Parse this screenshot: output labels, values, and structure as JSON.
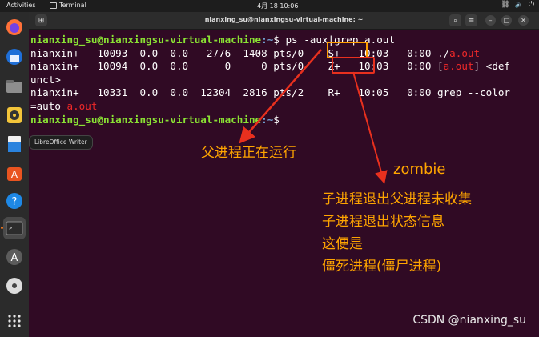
{
  "topbar": {
    "activities": "Activities",
    "app_name": "Terminal",
    "clock": "4月 18  10:06"
  },
  "window": {
    "title": "nianxing_su@nianxingsu-virtual-machine: ~"
  },
  "terminal": {
    "line1_prompt": "nianxing_su@nianxingsu-virtual-machine",
    "line1_path": ":~",
    "line1_cmd": "$ ps -aux|grep a.out",
    "line2_pre": "nianxin+   10093  0.0  0.0   2776  1408 pts/0    S+   10:03   0:00 ./",
    "line2_red": "a.out",
    "line3_pre": "nianxin+   10094  0.0  0.0      0     0 pts/0    Z+   10:03   0:00 [",
    "line3_red": "a.out",
    "line3_post": "] <def",
    "line4": "unct>",
    "line5": "nianxin+   10331  0.0  0.0  12304  2816 pts/2    R+   10:05   0:00 grep --color",
    "line6_pre": "=auto ",
    "line6_red": "a.out",
    "line7_prompt": "nianxing_su@nianxingsu-virtual-machine",
    "line7_path": ":~",
    "line7_cmd": "$"
  },
  "tooltip": "LibreOffice Writer",
  "annotations": {
    "parent_running": "父进程正在运行",
    "zombie": "zombie",
    "exp1": "子进程退出父进程未收集",
    "exp2": "子进程退出状态信息",
    "exp3": "这便是",
    "exp4": "僵死进程(僵尸进程)"
  },
  "watermark": "CSDN @nianxing_su",
  "colors": {
    "annotation_orange": "#ffa500",
    "box_orange": "#ff9f00",
    "box_red": "#e8301e",
    "arrow_red": "#e8301e"
  }
}
